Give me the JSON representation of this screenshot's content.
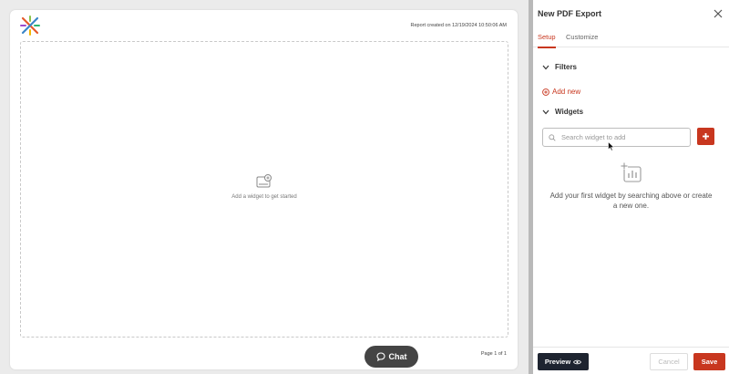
{
  "report": {
    "created_text": "Report created on 12/19/2024 10:50:06 AM",
    "empty_text": "Add a widget to get started",
    "page_indicator": "Page 1 of 1",
    "chat_label": "Chat"
  },
  "panel": {
    "title": "New PDF Export",
    "tabs": [
      {
        "label": "Setup",
        "active": true
      },
      {
        "label": "Customize",
        "active": false
      }
    ],
    "filters": {
      "heading": "Filters",
      "add_new_label": "Add new"
    },
    "widgets": {
      "heading": "Widgets",
      "search_placeholder": "Search widget to add",
      "empty_text": "Add your first widget by searching above or create a new one."
    },
    "footer": {
      "preview_label": "Preview",
      "cancel_label": "Cancel",
      "save_label": "Save"
    }
  },
  "colors": {
    "accent": "#c8371f",
    "dark_button": "#1e2430",
    "chat_bg": "#444444"
  },
  "icons": [
    "logo-icon",
    "add-widget-placeholder-icon",
    "chat-icon",
    "close-icon",
    "chevron-down-icon",
    "plus-circle-icon",
    "search-icon",
    "plus-icon",
    "chart-add-icon",
    "eye-icon",
    "cursor-icon"
  ]
}
